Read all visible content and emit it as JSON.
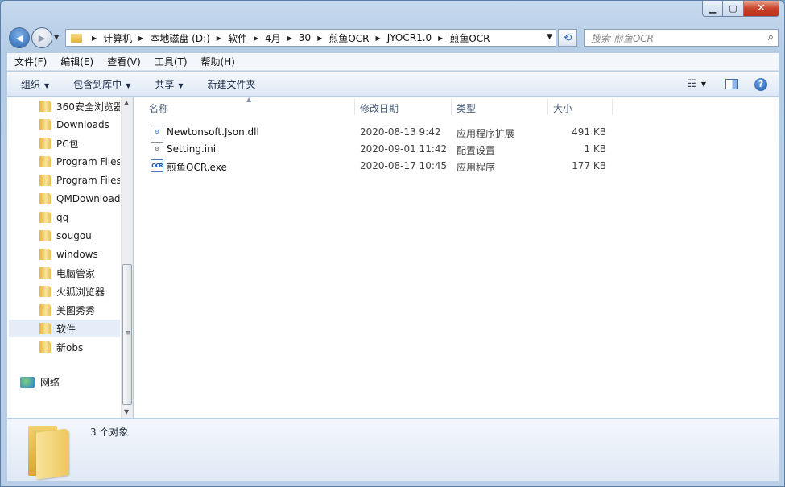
{
  "window": {
    "controls": {
      "minimize": "▁",
      "maximize": "▢",
      "close": "✕"
    }
  },
  "nav": {
    "back_icon": "◀",
    "forward_icon": "▶",
    "history_icon": "▼",
    "breadcrumbs": [
      "计算机",
      "本地磁盘 (D:)",
      "软件",
      "4月",
      "30",
      "煎鱼OCR",
      "JYOCR1.0",
      "煎鱼OCR"
    ],
    "search_placeholder": "搜索 煎鱼OCR"
  },
  "menu": [
    "文件(F)",
    "编辑(E)",
    "查看(V)",
    "工具(T)",
    "帮助(H)"
  ],
  "commands": [
    "组织",
    "包含到库中",
    "共享",
    "新建文件夹"
  ],
  "tree": {
    "items": [
      {
        "label": "360安全浏览器"
      },
      {
        "label": "Downloads"
      },
      {
        "label": "PC包"
      },
      {
        "label": "Program Files"
      },
      {
        "label": "Program Files"
      },
      {
        "label": "QMDownload"
      },
      {
        "label": "qq"
      },
      {
        "label": "sougou"
      },
      {
        "label": "windows"
      },
      {
        "label": "电脑管家"
      },
      {
        "label": "火狐浏览器"
      },
      {
        "label": "美图秀秀"
      },
      {
        "label": "软件"
      },
      {
        "label": "新obs"
      }
    ],
    "selected_index": 12,
    "network": "网络"
  },
  "columns": {
    "name": "名称",
    "date": "修改日期",
    "type": "类型",
    "size": "大小"
  },
  "files": [
    {
      "name": "Newtonsoft.Json.dll",
      "date": "2020-08-13 9:42",
      "type": "应用程序扩展",
      "size": "491 KB",
      "icon": "dll-icon"
    },
    {
      "name": "Setting.ini",
      "date": "2020-09-01 11:42",
      "type": "配置设置",
      "size": "1 KB",
      "icon": "ini-icon"
    },
    {
      "name": "煎鱼OCR.exe",
      "date": "2020-08-17 10:45",
      "type": "应用程序",
      "size": "177 KB",
      "icon": "exe-icon"
    }
  ],
  "details": {
    "count": "3 个对象"
  },
  "icons": {
    "exe_text": "OCR"
  }
}
